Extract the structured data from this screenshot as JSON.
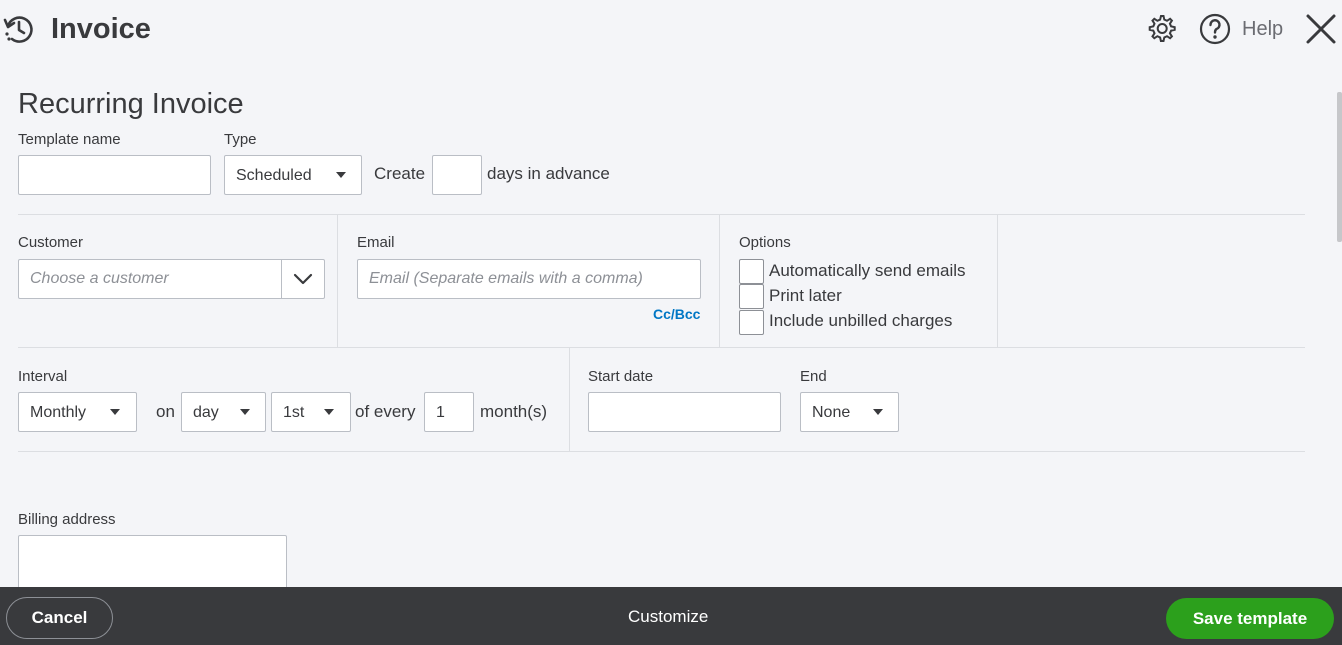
{
  "header": {
    "title": "Invoice",
    "help_label": "Help",
    "icons": [
      "recurring-clock-icon",
      "gear-icon",
      "help-icon",
      "close-icon"
    ]
  },
  "page_title": "Recurring Invoice",
  "template": {
    "template_name_label": "Template name",
    "template_name_value": "",
    "type_label": "Type",
    "type_value": "Scheduled",
    "create_label": "Create",
    "days_value": "",
    "days_suffix": "days in advance"
  },
  "customer": {
    "label": "Customer",
    "placeholder": "Choose a customer"
  },
  "email": {
    "label": "Email",
    "placeholder": "Email (Separate emails with a comma)",
    "cc_bcc": "Cc/Bcc"
  },
  "options": {
    "label": "Options",
    "items": [
      {
        "label": "Automatically send emails",
        "checked": false
      },
      {
        "label": "Print later",
        "checked": false
      },
      {
        "label": "Include unbilled charges",
        "checked": false
      }
    ]
  },
  "interval": {
    "label": "Interval",
    "frequency": "Monthly",
    "on_label": "on",
    "day_mode": "day",
    "day_of_month": "1st",
    "of_every_label": "of every",
    "every_value": "1",
    "unit_label": "month(s)"
  },
  "start_date": {
    "label": "Start date",
    "value": ""
  },
  "end": {
    "label": "End",
    "value": "None"
  },
  "billing": {
    "label": "Billing address",
    "value": ""
  },
  "footer": {
    "cancel_label": "Cancel",
    "customize_label": "Customize",
    "save_label": "Save template"
  },
  "colors": {
    "background": "#f4f5f8",
    "footer": "#393a3d",
    "primary_button": "#2ca01c",
    "link": "#0077c5"
  }
}
